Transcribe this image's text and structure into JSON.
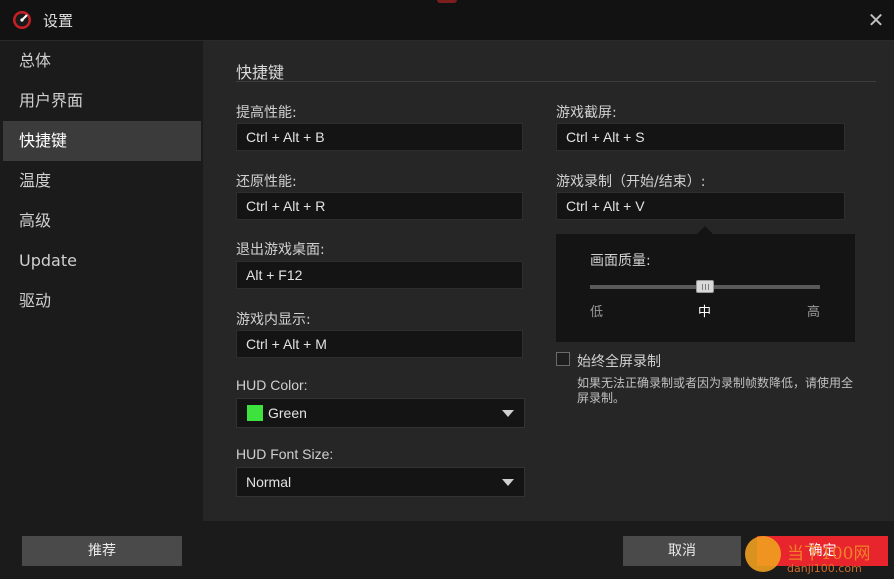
{
  "window": {
    "title": "设置",
    "close_glyph": "✕"
  },
  "sidebar": {
    "items": [
      {
        "label": "总体"
      },
      {
        "label": "用户界面"
      },
      {
        "label": "快捷键",
        "active": true
      },
      {
        "label": "温度"
      },
      {
        "label": "高级"
      },
      {
        "label": "Update"
      },
      {
        "label": "驱动"
      }
    ]
  },
  "hotkeys": {
    "section_title": "快捷键",
    "boost": {
      "label": "提高性能:",
      "value": "Ctrl + Alt + B"
    },
    "restore": {
      "label": "还原性能:",
      "value": "Ctrl + Alt + R"
    },
    "exit_desktop": {
      "label": "退出游戏桌面:",
      "value": "Alt + F12"
    },
    "in_game_display": {
      "label": "游戏内显示:",
      "value": "Ctrl + Alt + M"
    },
    "hud_color": {
      "label": "HUD Color:",
      "value": "Green",
      "swatch_color": "#3ee23e"
    },
    "hud_font_size": {
      "label": "HUD Font Size:",
      "value": "Normal"
    },
    "screenshot": {
      "label": "游戏截屏:",
      "value": "Ctrl + Alt + S"
    },
    "record": {
      "label": "游戏录制（开始/结束）:",
      "value": "Ctrl + Alt + V"
    },
    "quality": {
      "label": "画面质量:",
      "level_fraction": 0.5,
      "ticks": [
        "低",
        "中",
        "高"
      ],
      "current": "中"
    },
    "always_fullscreen": {
      "label": "始终全屏录制",
      "checked": false
    },
    "hint": "如果无法正确录制或者因为录制帧数降低，请使用全屏录制。"
  },
  "footer": {
    "recommend_label": "推荐",
    "cancel_label": "取消",
    "ok_label": "确定"
  },
  "watermark": {
    "text": "当下100网",
    "url": "danji100.com"
  },
  "colors": {
    "accent_red": "#e8242d",
    "active_item_bg": "#3b3b3b",
    "panel_bg": "#262626"
  }
}
